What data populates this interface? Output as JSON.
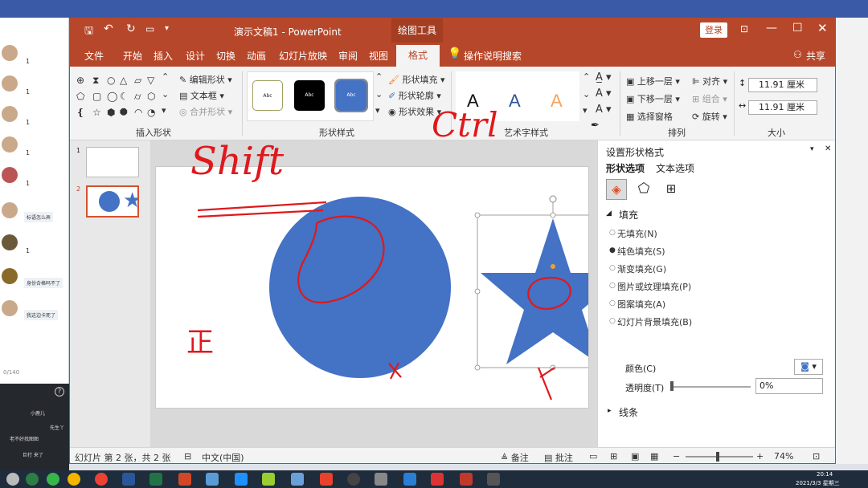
{
  "window": {
    "title": "演示文稿1  -  PowerPoint",
    "context_tab_group": "绘图工具",
    "login_button": "登录",
    "share_label": "共享"
  },
  "tabs": [
    "文件",
    "开始",
    "插入",
    "设计",
    "切换",
    "动画",
    "幻灯片放映",
    "审阅",
    "视图",
    "格式"
  ],
  "search": {
    "placeholder": "操作说明搜索"
  },
  "ribbon": {
    "insert_shapes": {
      "label": "插入形状",
      "edit_shape": "编辑形状",
      "text_box": "文本框",
      "merge_shapes": "合并形状"
    },
    "shape_styles": {
      "label": "形状样式",
      "sample_text": "Abc",
      "fill": "形状填充",
      "outline": "形状轮廓",
      "effects": "形状效果"
    },
    "wordart": {
      "label": "艺术字样式",
      "sample": "A"
    },
    "arrange": {
      "label": "排列",
      "bring_forward": "上移一层",
      "send_backward": "下移一层",
      "selection_pane": "选择窗格",
      "align": "对齐",
      "group": "组合",
      "rotate": "旋转"
    },
    "size": {
      "label": "大小",
      "height": "11.91 厘米",
      "width": "11.91 厘米"
    }
  },
  "slides": [
    {
      "number": "1"
    },
    {
      "number": "2"
    }
  ],
  "format_pane": {
    "title": "设置形状格式",
    "tab_shape": "形状选项",
    "tab_text": "文本选项",
    "fill_section": "填充",
    "fill_options": [
      "无填充(N)",
      "纯色填充(S)",
      "渐变填充(G)",
      "图片或纹理填充(P)",
      "图案填充(A)",
      "幻灯片背景填充(B)"
    ],
    "color_label": "颜色(C)",
    "transparency_label": "透明度(T)",
    "transparency_value": "0%",
    "line_section": "线条"
  },
  "status": {
    "slide_info": "幻灯片 第 2 张，共 2 张",
    "language": "中文(中国)",
    "notes": "备注",
    "comments": "批注",
    "zoom": "74%"
  },
  "annotations": {
    "shift": "Shift",
    "ctrl": "Ctrl",
    "zheng": "正"
  },
  "chat": {
    "counter": "0/140",
    "items": [
      "标语怎么弄",
      "身份合格吗不了",
      "我这边卡死了"
    ],
    "counts": [
      "1",
      "1",
      "1",
      "1",
      "1",
      "1"
    ],
    "dark_lines": [
      "小鹿儿",
      "先生丫",
      "老不好找图图",
      "巨打 来了"
    ]
  },
  "taskbar": {
    "time": "20:14",
    "date": "2021/3/3 星期三"
  },
  "colors": {
    "ppt_red": "#b7472a",
    "shape_blue": "#4472c4",
    "ink_red": "#e0181b"
  }
}
